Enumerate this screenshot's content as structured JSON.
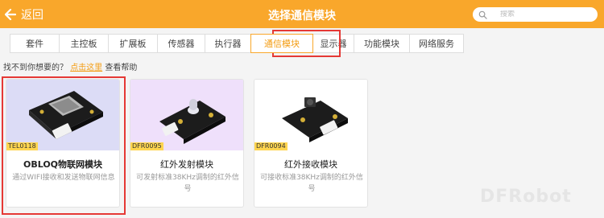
{
  "header": {
    "back_label": "返回",
    "title": "选择通信模块",
    "search_placeholder": "搜索"
  },
  "tabs": [
    {
      "label": "套件"
    },
    {
      "label": "主控板"
    },
    {
      "label": "扩展板"
    },
    {
      "label": "传感器"
    },
    {
      "label": "执行器"
    },
    {
      "label": "通信模块"
    },
    {
      "label": "显示器"
    },
    {
      "label": "功能模块"
    },
    {
      "label": "网络服务"
    }
  ],
  "active_tab": "通信模块",
  "help": {
    "prefix": "找不到你想要的？",
    "link": "点击这里",
    "suffix": "查看帮助"
  },
  "cards": [
    {
      "code": "TEL0118",
      "name": "OBLOQ物联网模块",
      "desc": "通过WIFI接收和发送物联网信息",
      "bg": "#dcdcf6"
    },
    {
      "code": "DFR0095",
      "name": "红外发射模块",
      "desc": "可发射标准38KHz调制的红外信号",
      "bg": "#efe0fb"
    },
    {
      "code": "DFR0094",
      "name": "红外接收模块",
      "desc": "可接收标准38KHz调制的红外信号",
      "bg": "#ffffff"
    }
  ],
  "colors": {
    "accent": "#f9a72b",
    "highlight": "#e53935",
    "code_badge": "#ffd54f"
  }
}
